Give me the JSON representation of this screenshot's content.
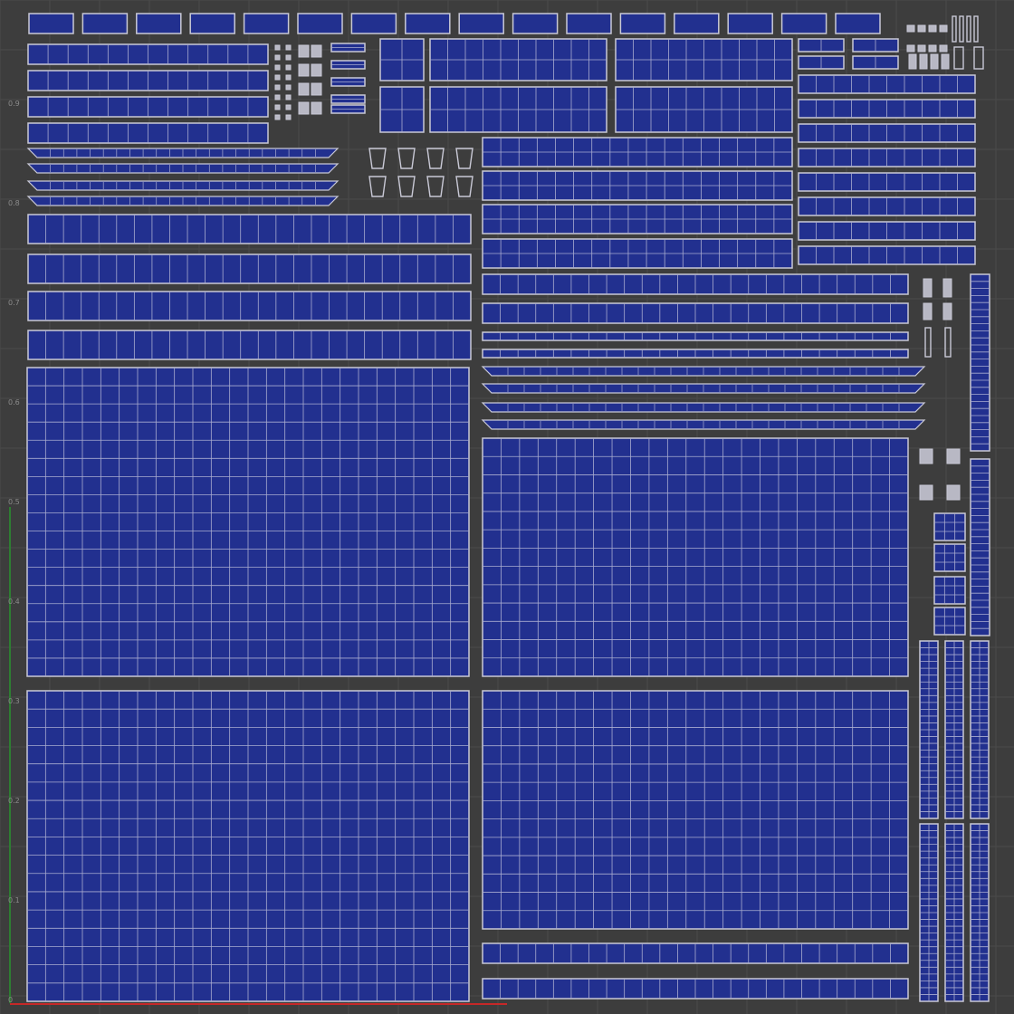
{
  "viewport": {
    "background": "#3d3d3d",
    "grid_color": "#4a4a4a",
    "island_fill": "#22308f",
    "island_edge": "#c9c9d6",
    "island_wire": "#a9acd0",
    "accent_v_axis": "#2e7d32",
    "accent_u_axis": "#c62828"
  },
  "axis_labels": [
    "0.9",
    "0.8",
    "0.7",
    "0.6",
    "0.5",
    "0.4",
    "0.3",
    "0.2",
    "0.1",
    "0"
  ]
}
